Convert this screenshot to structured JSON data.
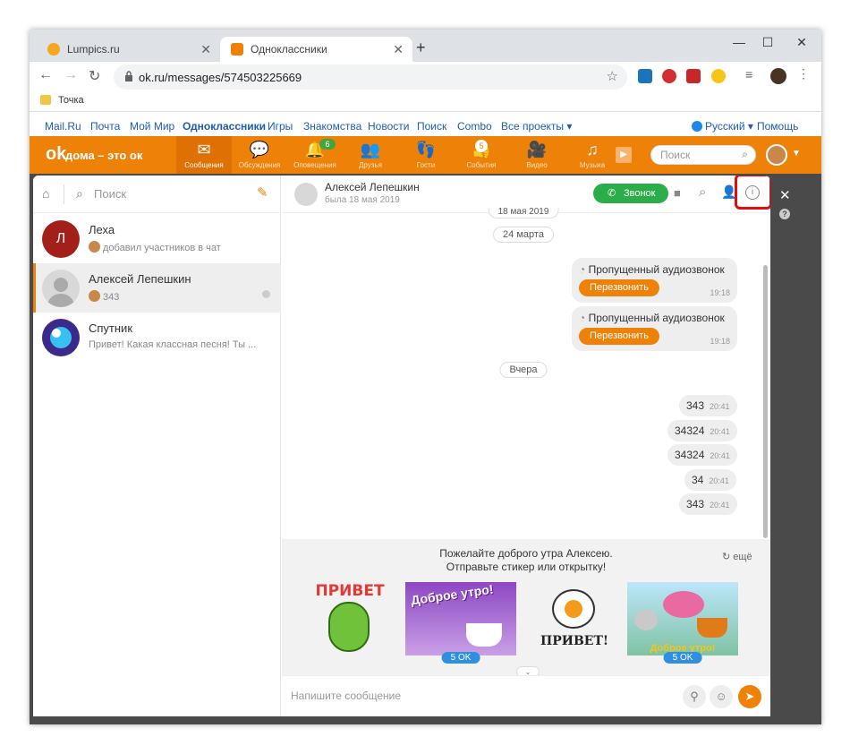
{
  "browser": {
    "tabs": [
      {
        "title": "Lumpics.ru",
        "fav_color": "#f5a623"
      },
      {
        "title": "Одноклассники",
        "fav_color": "#ee8208"
      }
    ],
    "new_tab": "+",
    "url": "ok.ru/messages/574503225669",
    "bookmark": "Точка"
  },
  "top_links": {
    "left": [
      "Mail.Ru",
      "Почта",
      "Мой Мир",
      "Одноклассники",
      "Игры",
      "Знакомства",
      "Новости",
      "Поиск",
      "Combo",
      "Все проекты ▾"
    ],
    "language": "Русский ▾",
    "help": "Помощь"
  },
  "okbar": {
    "logo": "дома – это ок",
    "nav": [
      {
        "label": "Сообщения",
        "icon": "envelope-icon",
        "glyph": "✉"
      },
      {
        "label": "Обсуждения",
        "icon": "chat-bubbles-icon",
        "glyph": "💬"
      },
      {
        "label": "Оповещения",
        "icon": "bell-icon",
        "glyph": "🔔",
        "badge": "6"
      },
      {
        "label": "Друзья",
        "icon": "friends-icon",
        "glyph": "👥"
      },
      {
        "label": "Гости",
        "icon": "footprints-icon",
        "glyph": "👣"
      },
      {
        "label": "События",
        "icon": "events-icon",
        "glyph": "👍",
        "badge": "5"
      },
      {
        "label": "Видео",
        "icon": "video-icon",
        "glyph": "🎥"
      },
      {
        "label": "Музыка",
        "icon": "music-icon",
        "glyph": "♫"
      }
    ],
    "search_placeholder": "Поиск"
  },
  "left_pane": {
    "search_placeholder": "Поиск",
    "conversations": [
      {
        "name": "Леха",
        "preview": "добавил участников в чат",
        "avatar_letter": "Л",
        "avatar_color": "#a3201a"
      },
      {
        "name": "Алексей Лепешкин",
        "preview": "343",
        "avatar_letter": "",
        "avatar_color": "#d8d8d8"
      },
      {
        "name": "Спутник",
        "preview": "Привет! Какая классная песня! Ты ...",
        "avatar_letter": "",
        "avatar_color": "#3b2a8c"
      }
    ]
  },
  "chat": {
    "contact_name": "Алексей Лепешкин",
    "contact_status": "была 18 мая 2019",
    "call_label": "Звонок",
    "date_top": "18 мая 2019",
    "date_1": "24 марта",
    "missed_calls": [
      {
        "text": "Пропущенный аудиозвонок",
        "button": "Перезвонить",
        "time": "19:18"
      },
      {
        "text": "Пропущенный аудиозвонок",
        "button": "Перезвонить",
        "time": "19:18"
      }
    ],
    "date_2": "Вчера",
    "messages": [
      {
        "text": "343",
        "time": "20:41"
      },
      {
        "text": "34324",
        "time": "20:41"
      },
      {
        "text": "34324",
        "time": "20:41"
      },
      {
        "text": "34",
        "time": "20:41"
      },
      {
        "text": "343",
        "time": "20:41"
      }
    ]
  },
  "suggest": {
    "line1": "Пожелайте доброго утра Алексею.",
    "line2": "Отправьте стикер или открытку!",
    "more": "ещё",
    "stickers": [
      {
        "caption": "ПРИВЕТ",
        "badge": ""
      },
      {
        "caption": "Доброе утро!",
        "badge": "5 OK"
      },
      {
        "caption": "ПРИВЕТ!",
        "badge": ""
      },
      {
        "caption": "Доброе утро!",
        "badge": "5 OK"
      }
    ]
  },
  "compose": {
    "placeholder": "Напишите сообщение"
  }
}
